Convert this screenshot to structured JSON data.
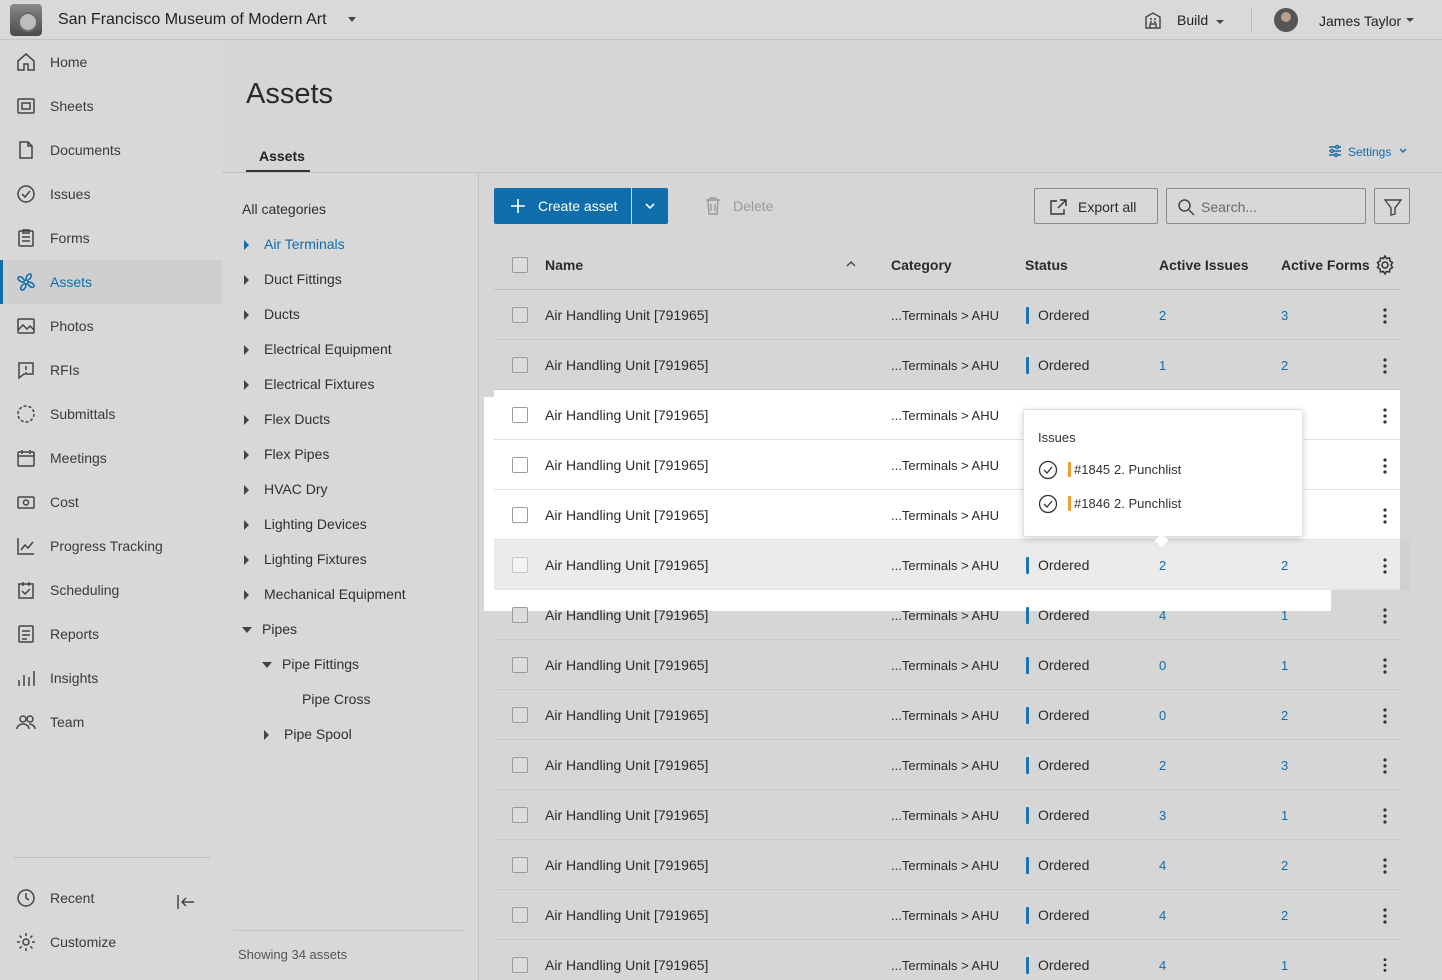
{
  "topbar": {
    "project_name": "San Francisco Museum of Modern Art",
    "module": "Build",
    "user_name": "James Taylor"
  },
  "sidebar": {
    "items": [
      {
        "label": "Home",
        "icon": "home-icon"
      },
      {
        "label": "Sheets",
        "icon": "sheets-icon"
      },
      {
        "label": "Documents",
        "icon": "document-icon"
      },
      {
        "label": "Issues",
        "icon": "issues-icon"
      },
      {
        "label": "Forms",
        "icon": "forms-icon"
      },
      {
        "label": "Assets",
        "icon": "assets-icon",
        "active": true
      },
      {
        "label": "Photos",
        "icon": "photos-icon"
      },
      {
        "label": "RFIs",
        "icon": "rfi-icon"
      },
      {
        "label": "Submittals",
        "icon": "submittals-icon"
      },
      {
        "label": "Meetings",
        "icon": "meetings-icon"
      },
      {
        "label": "Cost",
        "icon": "cost-icon"
      },
      {
        "label": "Progress Tracking",
        "icon": "progress-icon"
      },
      {
        "label": "Scheduling",
        "icon": "scheduling-icon"
      },
      {
        "label": "Reports",
        "icon": "reports-icon"
      },
      {
        "label": "Insights",
        "icon": "insights-icon"
      },
      {
        "label": "Team",
        "icon": "team-icon"
      }
    ],
    "bottom": [
      {
        "label": "Recent",
        "icon": "clock-icon"
      },
      {
        "label": "Customize",
        "icon": "gear-icon"
      }
    ]
  },
  "page": {
    "title": "Assets",
    "tab": "Assets",
    "settings_label": "Settings"
  },
  "tree": {
    "root": "All categories",
    "items": [
      {
        "label": "Air Terminals",
        "arrow": "right",
        "active": true
      },
      {
        "label": "Duct Fittings",
        "arrow": "right"
      },
      {
        "label": "Ducts",
        "arrow": "right"
      },
      {
        "label": "Electrical Equipment",
        "arrow": "right"
      },
      {
        "label": "Electrical Fixtures",
        "arrow": "right"
      },
      {
        "label": "Flex Ducts",
        "arrow": "right"
      },
      {
        "label": "Flex Pipes",
        "arrow": "right"
      },
      {
        "label": "HVAC Dry",
        "arrow": "right"
      },
      {
        "label": "Lighting Devices",
        "arrow": "right"
      },
      {
        "label": "Lighting Fixtures",
        "arrow": "right"
      },
      {
        "label": "Mechanical Equipment",
        "arrow": "right"
      },
      {
        "label": "Pipes",
        "arrow": "down"
      },
      {
        "label": "Pipe Fittings",
        "arrow": "down",
        "level": 1
      },
      {
        "label": "Pipe Cross",
        "arrow": "none",
        "level": 2
      },
      {
        "label": "Pipe Spool",
        "arrow": "right",
        "level": 1
      }
    ],
    "footer": "Showing 34 assets"
  },
  "toolbar": {
    "create_label": "Create asset",
    "delete_label": "Delete",
    "export_label": "Export all",
    "search_placeholder": "Search..."
  },
  "table": {
    "columns": [
      "Name",
      "Category",
      "Status",
      "Active Issues",
      "Active Forms"
    ],
    "rows": [
      {
        "name": "Air Handling Unit [791965]",
        "category": "...Terminals > AHU",
        "status": "Ordered",
        "issues": "2",
        "forms": "3"
      },
      {
        "name": "Air Handling Unit [791965]",
        "category": "...Terminals > AHU",
        "status": "Ordered",
        "issues": "1",
        "forms": "2"
      },
      {
        "name": "Air Handling Unit [791965]",
        "category": "...Terminals > AHU",
        "status": "",
        "issues": "",
        "forms": ""
      },
      {
        "name": "Air Handling Unit [791965]",
        "category": "...Terminals > AHU",
        "status": "",
        "issues": "",
        "forms": ""
      },
      {
        "name": "Air Handling Unit [791965]",
        "category": "...Terminals > AHU",
        "status": "",
        "issues": "",
        "forms": ""
      },
      {
        "name": "Air Handling Unit [791965]",
        "category": "...Terminals > AHU",
        "status": "Ordered",
        "issues": "2",
        "forms": "2"
      },
      {
        "name": "Air Handling Unit [791965]",
        "category": "...Terminals > AHU",
        "status": "Ordered",
        "issues": "4",
        "forms": "1"
      },
      {
        "name": "Air Handling Unit [791965]",
        "category": "...Terminals > AHU",
        "status": "Ordered",
        "issues": "0",
        "forms": "1"
      },
      {
        "name": "Air Handling Unit [791965]",
        "category": "...Terminals > AHU",
        "status": "Ordered",
        "issues": "0",
        "forms": "2"
      },
      {
        "name": "Air Handling Unit [791965]",
        "category": "...Terminals > AHU",
        "status": "Ordered",
        "issues": "2",
        "forms": "3"
      },
      {
        "name": "Air Handling Unit [791965]",
        "category": "...Terminals > AHU",
        "status": "Ordered",
        "issues": "3",
        "forms": "1"
      },
      {
        "name": "Air Handling Unit [791965]",
        "category": "...Terminals > AHU",
        "status": "Ordered",
        "issues": "4",
        "forms": "2"
      },
      {
        "name": "Air Handling Unit [791965]",
        "category": "...Terminals > AHU",
        "status": "Ordered",
        "issues": "4",
        "forms": "2"
      },
      {
        "name": "Air Handling Unit [791965]",
        "category": "...Terminals > AHU",
        "status": "Ordered",
        "issues": "4",
        "forms": "1"
      }
    ]
  },
  "popover": {
    "title": "Issues",
    "items": [
      {
        "id": "#1845",
        "desc": "2. Punchlist"
      },
      {
        "id": "#1846",
        "desc": "2. Punchlist"
      }
    ]
  },
  "colors": {
    "accent": "#0f6dab",
    "status_bar": "#1a74b5",
    "issue_marker": "#f0a030"
  }
}
